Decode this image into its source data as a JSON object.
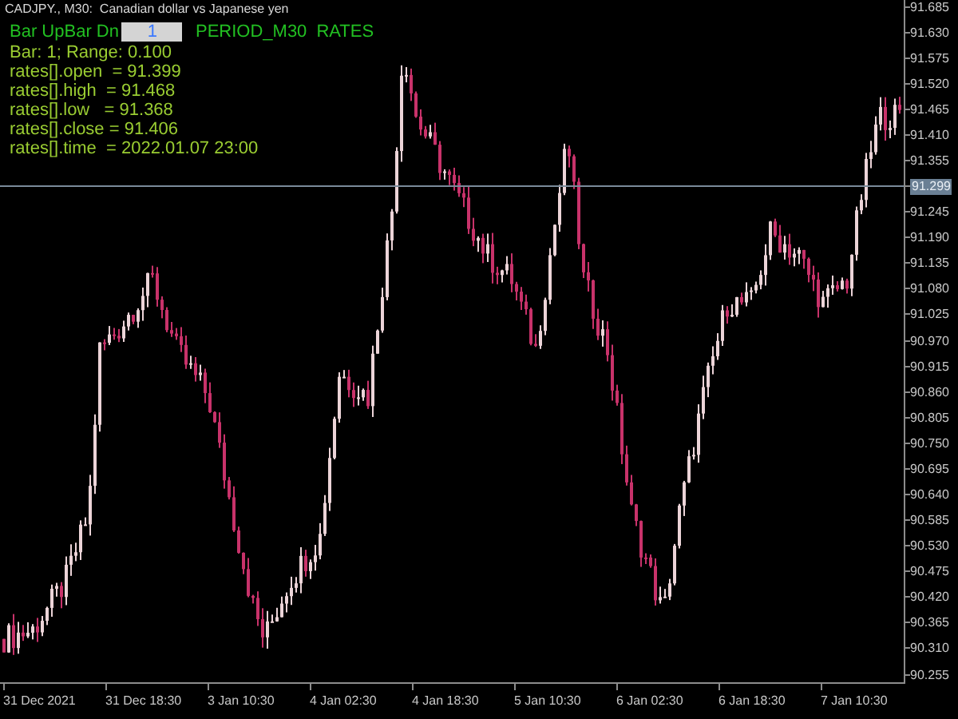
{
  "chart": {
    "symbol_title": "CADJPY., M30:  Canadian dollar vs Japanese yen",
    "panel": {
      "label": "Bar UpBar Dn",
      "input_value": "1",
      "period": "PERIOD_M30",
      "mode": "RATES",
      "info_lines": [
        "Bar: 1; Range: 0.100",
        "rates[].open  = 91.399",
        "rates[].high  = 91.468",
        "rates[].low   = 91.368",
        "rates[].close = 91.406",
        "rates[].time  = 2022.01.07 23:00"
      ]
    },
    "price_axis": [
      {
        "label": "91.685",
        "kind": "tick"
      },
      {
        "label": "91.630",
        "kind": "tick"
      },
      {
        "label": "91.575",
        "kind": "tick"
      },
      {
        "label": "91.520",
        "kind": "tick"
      },
      {
        "label": "91.465",
        "kind": "tick"
      },
      {
        "label": "91.410",
        "kind": "tick"
      },
      {
        "label": "91.355",
        "kind": "tick"
      },
      {
        "label": "91.299",
        "kind": "current"
      },
      {
        "label": "91.245",
        "kind": "tick"
      },
      {
        "label": "91.190",
        "kind": "tick"
      },
      {
        "label": "91.135",
        "kind": "tick"
      },
      {
        "label": "91.080",
        "kind": "tick"
      },
      {
        "label": "91.025",
        "kind": "tick"
      },
      {
        "label": "90.970",
        "kind": "tick"
      },
      {
        "label": "90.915",
        "kind": "tick"
      },
      {
        "label": "90.860",
        "kind": "tick"
      },
      {
        "label": "90.805",
        "kind": "tick"
      },
      {
        "label": "90.750",
        "kind": "tick"
      },
      {
        "label": "90.695",
        "kind": "tick"
      },
      {
        "label": "90.640",
        "kind": "tick"
      },
      {
        "label": "90.585",
        "kind": "tick"
      },
      {
        "label": "90.530",
        "kind": "tick"
      },
      {
        "label": "90.475",
        "kind": "tick"
      },
      {
        "label": "90.420",
        "kind": "tick"
      },
      {
        "label": "90.365",
        "kind": "tick"
      },
      {
        "label": "90.310",
        "kind": "tick"
      },
      {
        "label": "90.255",
        "kind": "tick"
      }
    ],
    "time_axis": [
      "31 Dec 2021",
      "31 Dec 18:30",
      "3 Jan 10:30",
      "4 Jan 02:30",
      "4 Jan 18:30",
      "5 Jan 10:30",
      "6 Jan 02:30",
      "6 Jan 18:30",
      "7 Jan 10:30"
    ]
  }
}
